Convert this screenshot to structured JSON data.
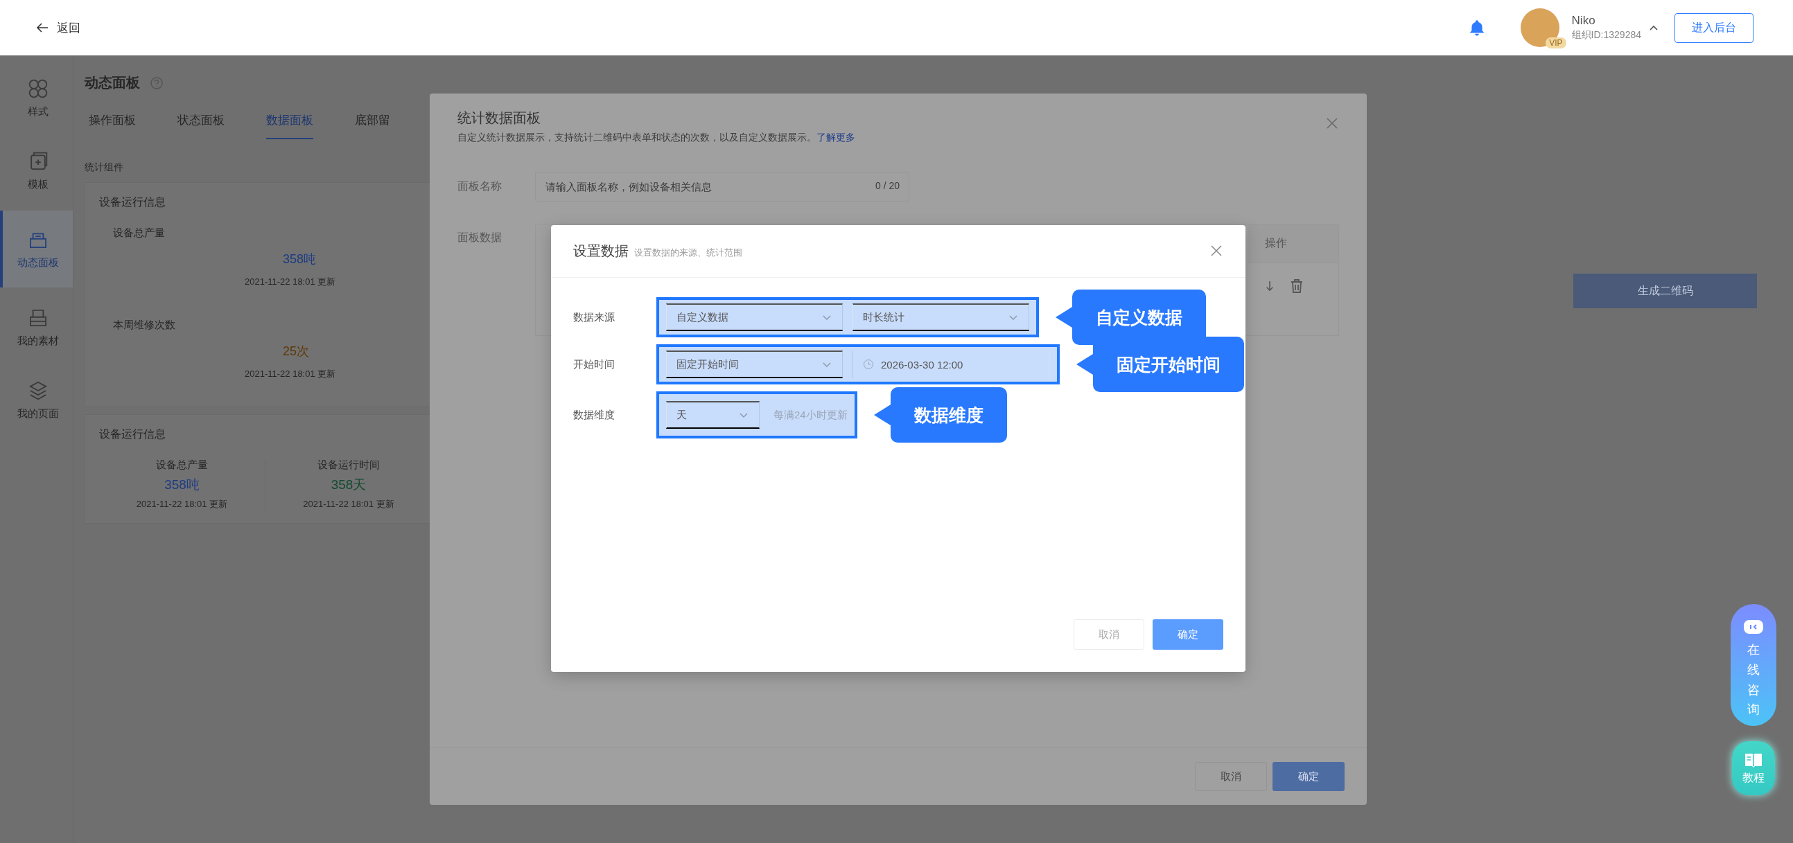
{
  "top_bar": {
    "back_label": "返回",
    "user": {
      "name": "Niko",
      "badge": "VIP",
      "org_id": "组织ID:1329284"
    },
    "admin_button": "进入后台"
  },
  "sidebar": {
    "items": [
      {
        "label": "样式",
        "selected": false
      },
      {
        "label": "模板",
        "selected": false
      },
      {
        "label": "动态面板",
        "selected": true
      },
      {
        "label": "我的素材",
        "selected": false
      },
      {
        "label": "我的页面",
        "selected": false
      }
    ]
  },
  "page": {
    "title": "动态面板",
    "tabs": [
      {
        "label": "操作面板",
        "selected": false
      },
      {
        "label": "状态面板",
        "selected": false
      },
      {
        "label": "数据面板",
        "selected": true
      },
      {
        "label": "底部留",
        "selected": false
      }
    ],
    "section_label": "统计组件",
    "cards": [
      {
        "title": "设备运行信息",
        "kind": "stacked",
        "metrics": [
          {
            "label": "设备总产量",
            "value": "358吨",
            "color": "#1e3c82",
            "updated": "2021-11-22 18:01 更新"
          },
          {
            "label": "本周维修次数",
            "value": "25次",
            "color": "#5e3a08",
            "updated": "2021-11-22 18:01 更新"
          }
        ]
      },
      {
        "title": "设备运行信息",
        "kind": "columns",
        "metrics": [
          {
            "label": "设备总产量",
            "value": "358吨",
            "color": "#1e3c82",
            "updated": "2021-11-22 18:01 更新"
          },
          {
            "label": "设备运行时间",
            "value": "358天",
            "color": "#134a30",
            "updated": "2021-11-22 18:01 更新"
          }
        ]
      }
    ],
    "qr_button": "生成二维码"
  },
  "stats_modal": {
    "title": "统计数据面板",
    "description": "自定义统计数据展示，支持统计二维码中表单和状态的次数，以及自定义数据展示。",
    "learn_more": "了解更多",
    "name_label": "面板名称",
    "name_field": {
      "placeholder": "请输入面板名称，例如设备相关信息",
      "counter": "0 / 20"
    },
    "data_label": "面板数据",
    "actions_column": "操作",
    "buttons": [
      {
        "label": "取消",
        "kind": "secondary"
      },
      {
        "label": "确定",
        "kind": "primary"
      }
    ]
  },
  "data_modal": {
    "title": "设置数据",
    "subtitle": "设置数据的来源、统计范围",
    "rows": [
      {
        "label": "数据来源",
        "callout": "自定义数据",
        "controls": [
          {
            "kind": "select",
            "value": "自定义数据"
          },
          {
            "kind": "select",
            "value": "时长统计"
          }
        ]
      },
      {
        "label": "开始时间",
        "callout": "固定开始时间",
        "controls": [
          {
            "kind": "select",
            "value": "固定开始时间"
          },
          {
            "kind": "datetime",
            "value": "2026-03-30 12:00"
          }
        ]
      },
      {
        "label": "数据维度",
        "callout": "数据维度",
        "controls": [
          {
            "kind": "select",
            "value": "天"
          },
          {
            "kind": "hint",
            "value": "每满24小时更新"
          }
        ]
      }
    ],
    "buttons": [
      {
        "label": "取消",
        "kind": "secondary"
      },
      {
        "label": "确定",
        "kind": "primary"
      }
    ]
  },
  "help": {
    "consult": "在线咨询",
    "tutorial": "教程"
  }
}
